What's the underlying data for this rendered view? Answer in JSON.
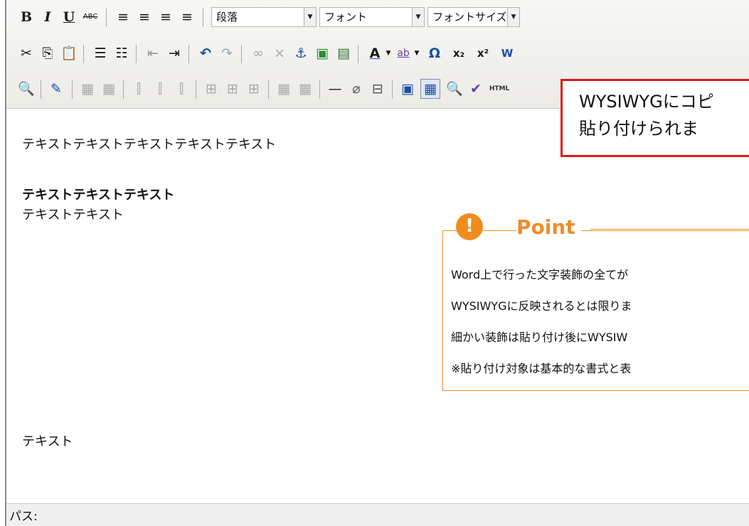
{
  "toolbar": {
    "row1": {
      "bold": "B",
      "italic": "I",
      "underline": "U",
      "strike": "ABC",
      "align_left": "≡",
      "align_center": "≡",
      "align_right": "≡",
      "align_full": "≡",
      "format_select": "段落",
      "font_select": "フォント",
      "size_select": "フォントサイズ"
    },
    "row2": {
      "cut": "✂",
      "copy": "⎘",
      "paste": "📋",
      "bullist": "☰",
      "numlist": "☷",
      "outdent": "⇤",
      "indent": "⇥",
      "undo": "↶",
      "redo": "↷",
      "link": "∞",
      "unlink": "⨯",
      "anchor": "⚓",
      "image": "▣",
      "media": "▤",
      "forecolor": "A",
      "backcolor": "ab",
      "charmap": "Ω",
      "sub": "x₂",
      "sup": "x²",
      "paste_word": "W"
    },
    "row3": {
      "find": "🔍",
      "edit": "✎",
      "table": "▦",
      "table2": "▦",
      "ins_col": "⫿",
      "ins_row": "⫿",
      "del_col": "⫿",
      "split": "⊞",
      "merge": "⊞",
      "del": "⊞",
      "cell": "▦",
      "row_props": "▦",
      "hr": "—",
      "removeformat": "⌀",
      "visualaid": "⊟",
      "fullscreen": "▣",
      "code": "▦",
      "preview": "🔍",
      "cleanup": "✔",
      "html": "HTML"
    }
  },
  "content": {
    "p1": "テキストテキストテキストテキストテキスト",
    "p2": "テキストテキストテキスト",
    "p3": "テキストテキスト",
    "p4": "テキスト"
  },
  "callout": {
    "line1": "WYSIWYGにコピ",
    "line2": "貼り付けられま"
  },
  "point": {
    "badge": "!",
    "title": "Point",
    "lines": [
      "Word上で行った文字装飾の全てが",
      "WYSIWYGに反映されるとは限りま",
      "細かい装飾は貼り付け後にWYSIW",
      "※貼り付け対象は基本的な書式と表"
    ]
  },
  "statusbar": {
    "path_label": "パス:"
  },
  "colors": {
    "callout_border": "#e01818",
    "point_accent": "#ee8d2a"
  }
}
